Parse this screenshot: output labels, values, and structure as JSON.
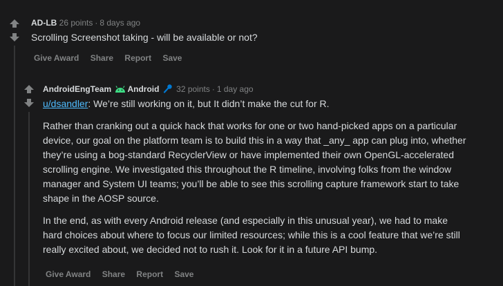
{
  "comment1": {
    "author": "AD-LB",
    "points": "26 points",
    "separator": "·",
    "age": "8 days ago",
    "text": "Scrolling Screenshot taking - will be available or not?",
    "actions": {
      "award": "Give Award",
      "share": "Share",
      "report": "Report",
      "save": "Save"
    }
  },
  "comment2": {
    "author": "AndroidEngTeam",
    "flair": "Android",
    "points": "32 points",
    "separator": "·",
    "age": "1 day ago",
    "mention": "u/dsandler",
    "paragraph1_rest": ": We’re still working on it, but It didn’t make the cut for R.",
    "paragraph2": "Rather than cranking out a quick hack that works for one or two hand-picked apps on a particular device, our goal on the platform team is to build this in a way that _any_ app can plug into, whether they’re using a bog-standard RecyclerView or have implemented their own OpenGL-accelerated scrolling engine. We investigated this throughout the R timeline, involving folks from the window manager and System UI teams; you’ll be able to see this scrolling capture framework start to take shape in the AOSP source.",
    "paragraph3": "In the end, as with every Android release (and especially in this unusual year), we had to make hard choices about where to focus our limited resources; while this is a cool feature that we’re still really excited about, we decided not to rush it. Look for it in a future API bump.",
    "actions": {
      "award": "Give Award",
      "share": "Share",
      "report": "Report",
      "save": "Save"
    }
  },
  "colors": {
    "background": "#1a1a1b",
    "text": "#d7dadc",
    "meta": "#818384",
    "link": "#4fbcff",
    "android_green": "#3ddc84",
    "mic_blue": "#0079d3"
  },
  "icons": [
    "upvote-icon",
    "downvote-icon",
    "android-icon",
    "microphone-icon"
  ]
}
